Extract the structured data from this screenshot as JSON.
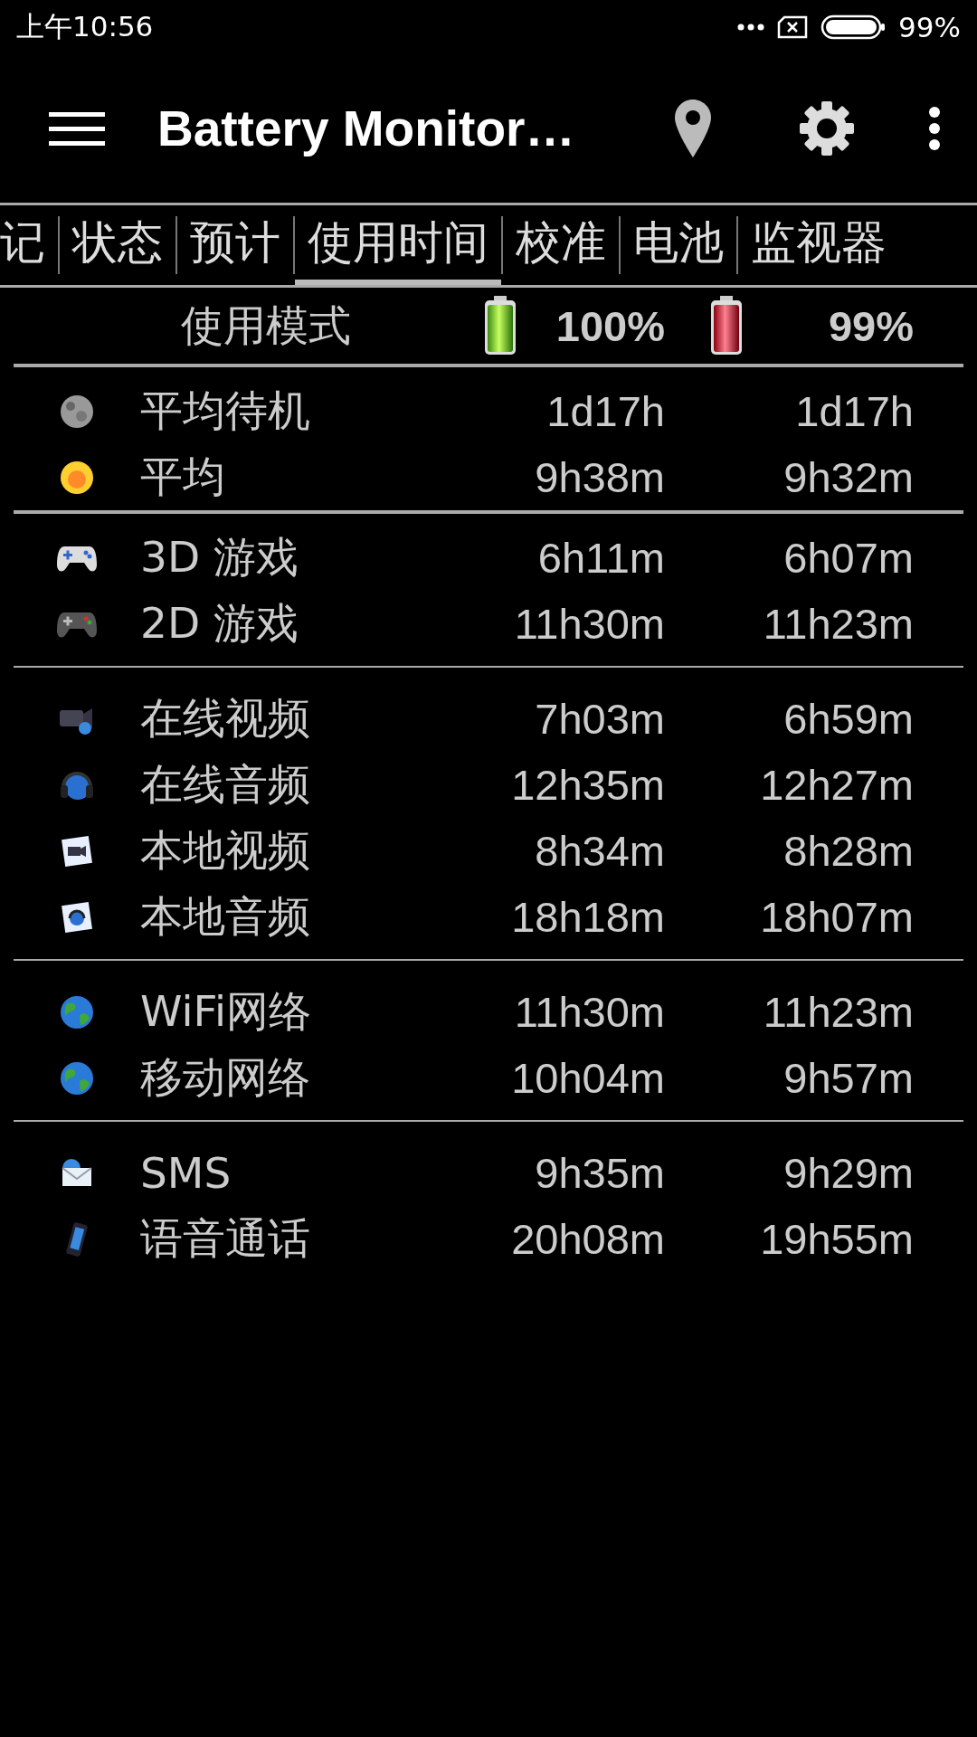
{
  "status_bar": {
    "time": "上午10:56",
    "battery": "99%"
  },
  "toolbar": {
    "title": "Battery Monitor…"
  },
  "tabs": [
    {
      "label": "记",
      "selected": false
    },
    {
      "label": "状态",
      "selected": false
    },
    {
      "label": "预计",
      "selected": false
    },
    {
      "label": "使用时间",
      "selected": true
    },
    {
      "label": "校准",
      "selected": false
    },
    {
      "label": "电池",
      "selected": false
    },
    {
      "label": "监视器",
      "selected": false
    }
  ],
  "header": {
    "label": "使用模式",
    "col_1": "100%",
    "col_2": "99%"
  },
  "sections": [
    {
      "rows": [
        {
          "kind": "moon",
          "name": "平均待机",
          "col_1": "1d17h",
          "col_2": "1d17h"
        },
        {
          "kind": "sun",
          "name": "平均",
          "col_1": "9h38m",
          "col_2": "9h32m"
        }
      ]
    },
    {
      "rows": [
        {
          "kind": "gamepad-light",
          "name": "3D 游戏",
          "col_1": "6h11m",
          "col_2": "6h07m"
        },
        {
          "kind": "gamepad-dark",
          "name": "2D 游戏",
          "col_1": "11h30m",
          "col_2": "11h23m"
        }
      ]
    },
    {
      "rows": [
        {
          "kind": "camera",
          "name": "在线视频",
          "col_1": "7h03m",
          "col_2": "6h59m"
        },
        {
          "kind": "headphones",
          "name": "在线音频",
          "col_1": "12h35m",
          "col_2": "12h27m"
        },
        {
          "kind": "video-file",
          "name": "本地视频",
          "col_1": "8h34m",
          "col_2": "8h28m"
        },
        {
          "kind": "audio-file",
          "name": "本地音频",
          "col_1": "18h18m",
          "col_2": "18h07m"
        }
      ]
    },
    {
      "rows": [
        {
          "kind": "globe",
          "name": "WiFi网络",
          "col_1": "11h30m",
          "col_2": "11h23m"
        },
        {
          "kind": "globe",
          "name": "移动网络",
          "col_1": "10h04m",
          "col_2": "9h57m"
        }
      ]
    },
    {
      "rows": [
        {
          "kind": "envelope",
          "name": "SMS",
          "col_1": "9h35m",
          "col_2": "9h29m"
        },
        {
          "kind": "phone",
          "name": "语音通话",
          "col_1": "20h08m",
          "col_2": "19h55m"
        }
      ]
    }
  ]
}
